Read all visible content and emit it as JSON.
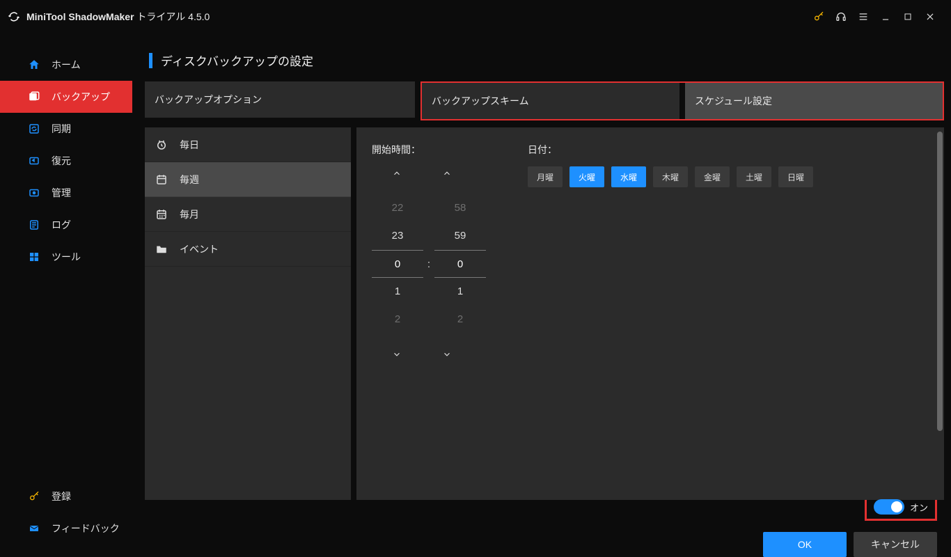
{
  "title": {
    "app": "MiniTool ShadowMaker",
    "trial": " トライアル 4.5.0"
  },
  "sidebar": {
    "items": [
      {
        "label": "ホーム"
      },
      {
        "label": "バックアップ"
      },
      {
        "label": "同期"
      },
      {
        "label": "復元"
      },
      {
        "label": "管理"
      },
      {
        "label": "ログ"
      },
      {
        "label": "ツール"
      }
    ],
    "bottom": [
      {
        "label": "登録"
      },
      {
        "label": "フィードバック"
      }
    ]
  },
  "page": {
    "title": "ディスクバックアップの設定"
  },
  "tabs": [
    {
      "label": "バックアップオプション"
    },
    {
      "label": "バックアップスキーム"
    },
    {
      "label": "スケジュール設定"
    }
  ],
  "schedule_modes": [
    {
      "label": "毎日"
    },
    {
      "label": "毎週"
    },
    {
      "label": "毎月"
    },
    {
      "label": "イベント"
    }
  ],
  "time": {
    "start_label": "開始時間：",
    "wheel_hour": {
      "f1": "22",
      "n1": "23",
      "cur": "0",
      "n2": "1",
      "f2": "2"
    },
    "wheel_minute": {
      "f1": "58",
      "n1": "59",
      "cur": "0",
      "n2": "1",
      "f2": "2"
    },
    "colon": ":"
  },
  "days": {
    "label": "日付：",
    "items": [
      {
        "label": "月曜",
        "on": false
      },
      {
        "label": "火曜",
        "on": true
      },
      {
        "label": "水曜",
        "on": true
      },
      {
        "label": "木曜",
        "on": false
      },
      {
        "label": "金曜",
        "on": false
      },
      {
        "label": "土曜",
        "on": false
      },
      {
        "label": "日曜",
        "on": false
      }
    ]
  },
  "footer": {
    "toggle": "オン",
    "ok": "OK",
    "cancel": "キャンセル"
  }
}
